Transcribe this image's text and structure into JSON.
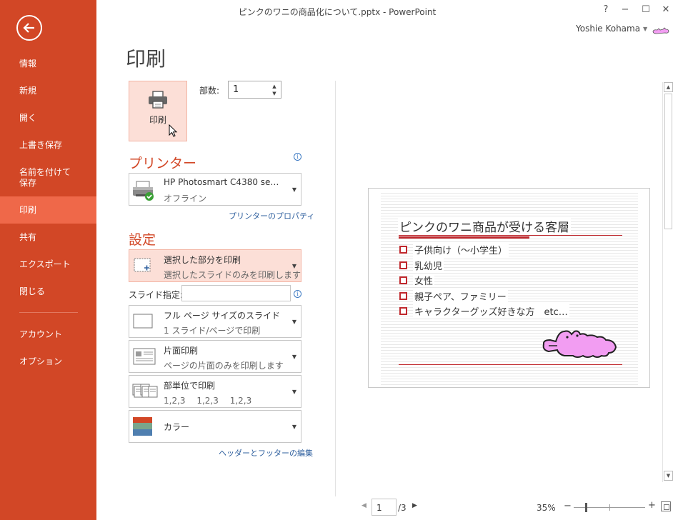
{
  "window": {
    "title": "ピンクのワニの商品化について.pptx - PowerPoint",
    "help": "?",
    "minimize": "−",
    "maximize": "☐",
    "close": "✕",
    "user_name": "Yoshie Kohama"
  },
  "nav": {
    "items": [
      {
        "label": "情報"
      },
      {
        "label": "新規"
      },
      {
        "label": "開く"
      },
      {
        "label": "上書き保存"
      },
      {
        "label": "名前を付けて\n保存"
      },
      {
        "label": "印刷",
        "active": true
      },
      {
        "label": "共有"
      },
      {
        "label": "エクスポート"
      },
      {
        "label": "閉じる"
      },
      {
        "label": "アカウント"
      },
      {
        "label": "オプション"
      }
    ]
  },
  "page_title": "印刷",
  "print": {
    "button_label": "印刷",
    "copies_label": "部数:",
    "copies_value": "1"
  },
  "printer": {
    "heading": "プリンター",
    "name": "HP Photosmart C4380 se…",
    "status": "オフライン",
    "properties_link": "プリンターのプロパティ"
  },
  "settings": {
    "heading": "設定",
    "range": {
      "title": "選択した部分を印刷",
      "sub": "選択したスライドのみを印刷します"
    },
    "slides_label": "スライド指定:",
    "slides_value": "",
    "layout": {
      "title": "フル ページ サイズのスライド",
      "sub": "1 スライド/ページで印刷"
    },
    "sides": {
      "title": "片面印刷",
      "sub": "ページの片面のみを印刷します"
    },
    "collate": {
      "title": "部単位で印刷",
      "sub": "1,2,3　 1,2,3　 1,2,3"
    },
    "color": {
      "title": "カラー"
    },
    "header_footer_link": "ヘッダーとフッターの編集"
  },
  "preview": {
    "slide_title": "ピンクのワニ商品が受ける客層",
    "bullets": [
      "子供向け（～小学生）",
      "乳幼児",
      "女性",
      "親子ペア、ファミリー",
      "キャラクターグッズ好きな方　etc…"
    ],
    "accent_color": "#c0282d",
    "croc_color": "#f29df2"
  },
  "pager": {
    "current": "1",
    "total": "/3"
  },
  "zoom": {
    "percent": "35%",
    "minus": "−",
    "plus": "+"
  }
}
